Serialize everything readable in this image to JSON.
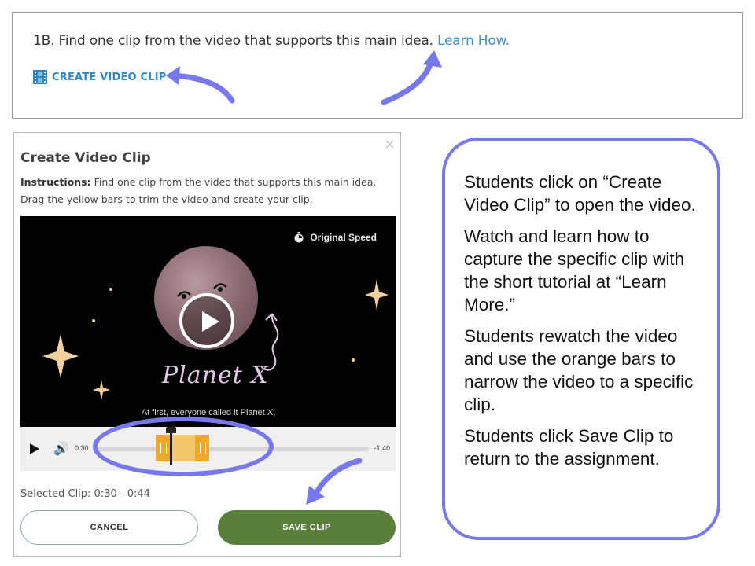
{
  "prompt": {
    "text": "1B. Find one clip from the video that supports this main idea. ",
    "learn_link": "Learn How.",
    "create_clip_label": "CREATE VIDEO CLIP",
    "accent_color": "#2f86c0"
  },
  "modal": {
    "close_label": "×",
    "title": "Create Video Clip",
    "instructions_label": "Instructions:",
    "instructions_text": " Find one clip from the video that supports this main idea. Drag the yellow bars to trim the video and create your clip.",
    "video": {
      "speed_label": "Original Speed",
      "planet_label": "Planet X",
      "caption": "At first, everyone called it Planet X,"
    },
    "controls": {
      "start_time": "0:30",
      "end_time": "-1:40",
      "selection_color": "#f0a82a"
    },
    "selected_clip_label": "Selected Clip:  0:30  -  0:44",
    "cancel_label": "CANCEL",
    "save_label": "SAVE CLIP",
    "save_color": "#5a7f3b"
  },
  "callout": {
    "paragraphs": [
      "Students click on “Create Video Clip” to open the video.",
      "Watch and learn how to capture the specific clip with the short tutorial at “Learn More.”",
      "Students rewatch the video and use the orange bars to narrow the video to a specific clip.",
      "Students click Save Clip to return to the assignment."
    ],
    "border_color": "#7777ee"
  }
}
